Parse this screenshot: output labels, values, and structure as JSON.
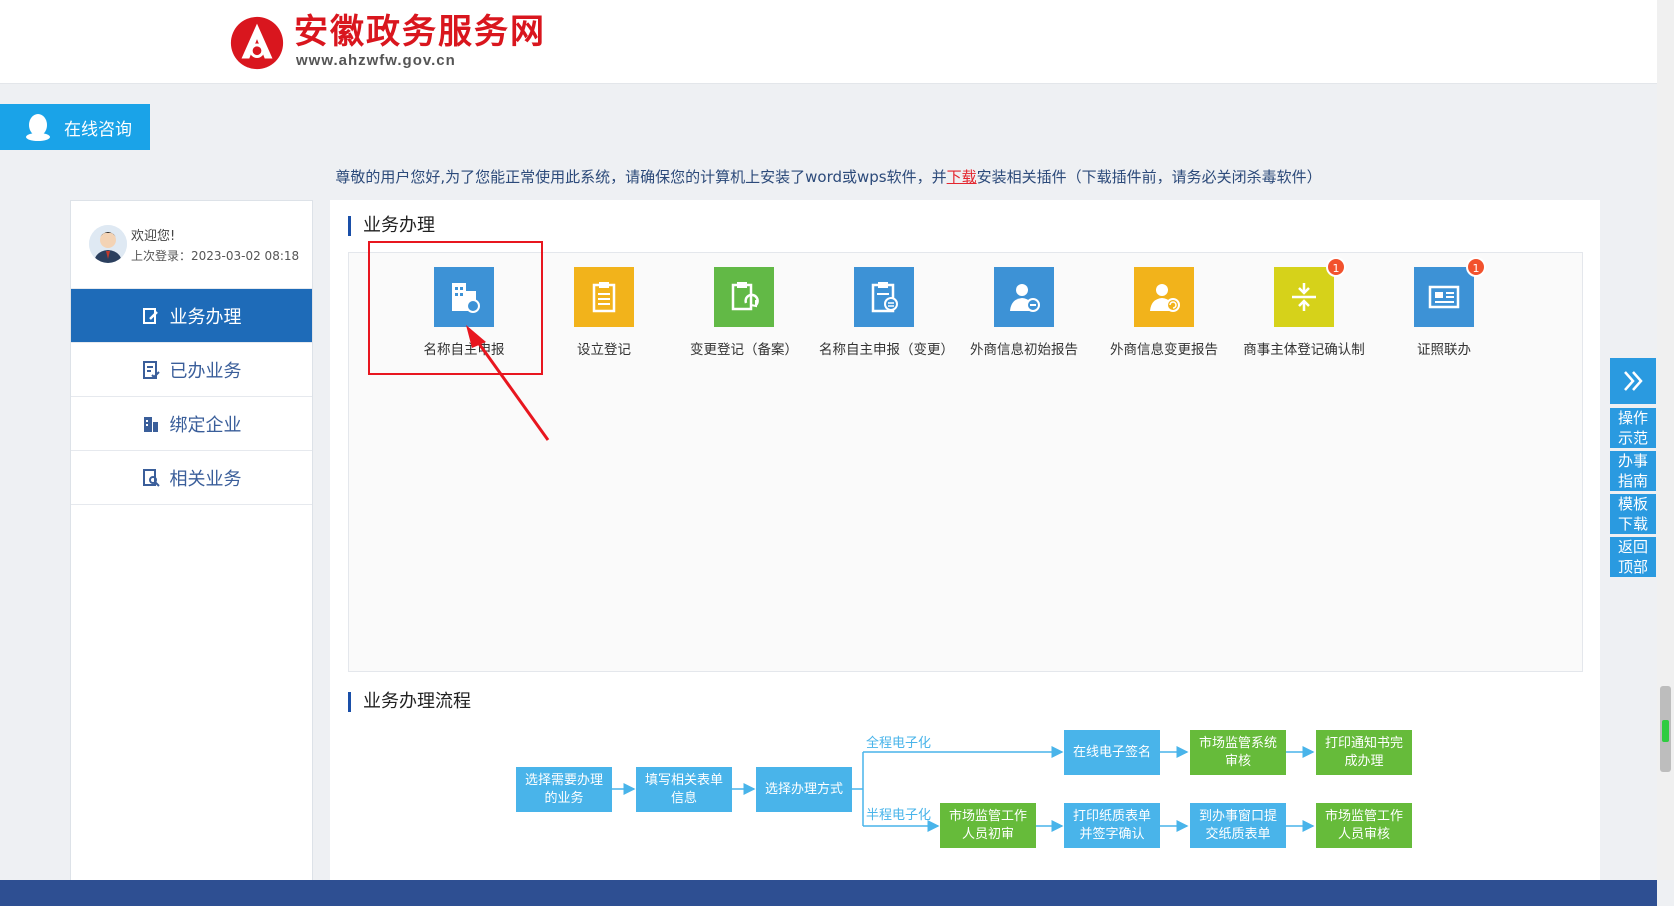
{
  "header": {
    "title": "安徽政务服务网",
    "subtitle": "www.ahzwfw.gov.cn"
  },
  "consult": {
    "label": "在线咨询"
  },
  "notice": {
    "before": "尊敬的用户您好,为了您能正常使用此系统，请确保您的计算机上安装了word或wps软件，并",
    "link": "下载",
    "after": "安装相关插件（下载插件前，请务必关闭杀毒软件）"
  },
  "user": {
    "welcome": "欢迎您!",
    "last_login": "上次登录：2023-03-02 08:18"
  },
  "sidebar": {
    "items": [
      {
        "label": "业务办理",
        "icon": "edit-doc-icon",
        "active": true
      },
      {
        "label": "已办业务",
        "icon": "done-doc-icon",
        "active": false
      },
      {
        "label": "绑定企业",
        "icon": "building-icon",
        "active": false
      },
      {
        "label": "相关业务",
        "icon": "search-doc-icon",
        "active": false
      }
    ]
  },
  "main": {
    "section1_title": "业务办理",
    "section2_title": "业务办理流程",
    "tiles": [
      {
        "label": "名称自主申报",
        "color": "#3d92d6",
        "icon": "building-name-icon"
      },
      {
        "label": "设立登记",
        "color": "#f2b31b",
        "icon": "clipboard-icon"
      },
      {
        "label": "变更登记（备案）",
        "color": "#62b946",
        "icon": "change-doc-icon"
      },
      {
        "label": "名称自主申报（变更）",
        "color": "#3d92d6",
        "icon": "name-change-icon"
      },
      {
        "label": "外商信息初始报告",
        "color": "#3d92d6",
        "icon": "foreign-person-icon"
      },
      {
        "label": "外商信息变更报告",
        "color": "#f2b31b",
        "icon": "foreign-change-icon"
      },
      {
        "label": "商事主体登记确认制",
        "color": "#d6d21a",
        "icon": "merge-icon",
        "badge": "1"
      },
      {
        "label": "证照联办",
        "color": "#3d92d6",
        "icon": "id-card-icon",
        "badge": "1"
      }
    ]
  },
  "flow": {
    "label_full": "全程电子化",
    "label_half": "半程电子化",
    "steps": {
      "s1": "选择需要办理的业务",
      "s2": "填写相关表单信息",
      "s3": "选择办理方式",
      "e1": "在线电子签名",
      "e2": "市场监管系统审核",
      "e3": "打印通知书完成办理",
      "h1": "市场监管工作人员初审",
      "h2": "打印纸质表单并签字确认",
      "h3": "到办事窗口提交纸质表单",
      "h4": "市场监管工作人员审核"
    }
  },
  "float": {
    "items": [
      "操作示范",
      "办事指南",
      "模板下载",
      "返回顶部"
    ]
  }
}
